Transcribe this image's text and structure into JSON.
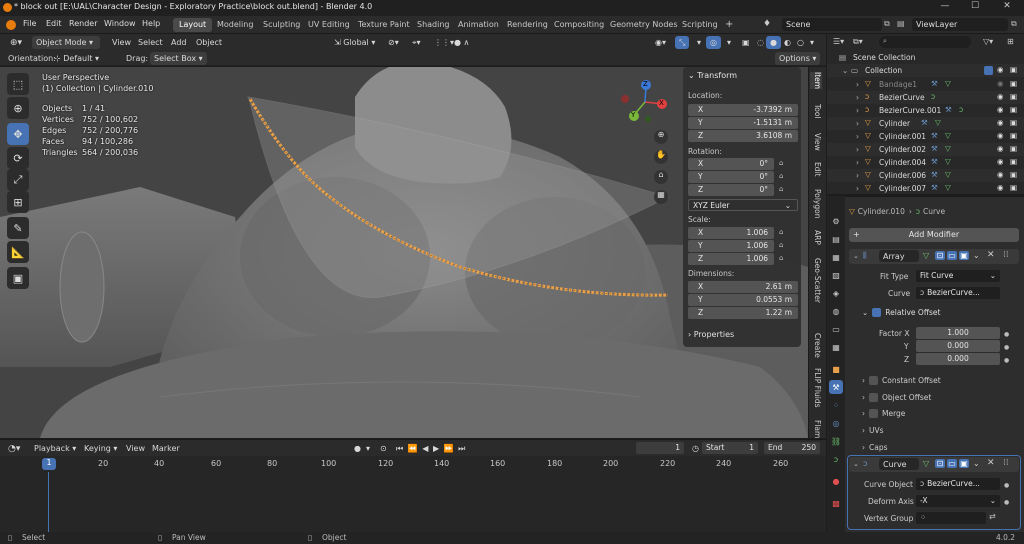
{
  "titlebar": {
    "title": "* block out [E:\\UAL\\Character Design - Exploratory Practice\\block out.blend] - Blender 4.0",
    "min": "—",
    "max": "☐",
    "close": "✕"
  },
  "menu": [
    "File",
    "Edit",
    "Render",
    "Window",
    "Help"
  ],
  "workspaces": [
    "Layout",
    "Modeling",
    "Sculpting",
    "UV Editing",
    "Texture Paint",
    "Shading",
    "Animation",
    "Rendering",
    "Compositing",
    "Geometry Nodes",
    "Scripting"
  ],
  "workspace_add": "+",
  "scene": "Scene",
  "view_layer": "ViewLayer",
  "viewport_header": {
    "mode": "Object Mode",
    "view": "View",
    "select": "Select",
    "add": "Add",
    "object": "Object",
    "transform_orientation": "Global",
    "orientation_label": "Orientation:",
    "orientation_value": "Default",
    "drag_label": "Drag:",
    "drag_value": "Select Box",
    "options": "Options"
  },
  "viewport_overlay": {
    "perspective": "User Perspective",
    "collection_line": "(1) Collection | Cylinder.010",
    "stats": [
      {
        "label": "Objects",
        "value": "1 / 41"
      },
      {
        "label": "Vertices",
        "value": "752 / 100,602"
      },
      {
        "label": "Edges",
        "value": "752 / 200,776"
      },
      {
        "label": "Faces",
        "value": "94 / 100,286"
      },
      {
        "label": "Triangles",
        "value": "564 / 200,036"
      }
    ],
    "gizmo": {
      "x": "X",
      "y": "Y",
      "z": "Z"
    }
  },
  "npanel": {
    "transform": "Transform",
    "location_label": "Location:",
    "location": [
      {
        "axis": "X",
        "value": "-3.7392 m"
      },
      {
        "axis": "Y",
        "value": "-1.5131 m"
      },
      {
        "axis": "Z",
        "value": "3.6108 m"
      }
    ],
    "rotation_label": "Rotation:",
    "rotation": [
      {
        "axis": "X",
        "value": "0°"
      },
      {
        "axis": "Y",
        "value": "0°"
      },
      {
        "axis": "Z",
        "value": "0°"
      }
    ],
    "rotation_mode": "XYZ Euler",
    "scale_label": "Scale:",
    "scale": [
      {
        "axis": "X",
        "value": "1.006"
      },
      {
        "axis": "Y",
        "value": "1.006"
      },
      {
        "axis": "Z",
        "value": "1.006"
      }
    ],
    "dimensions_label": "Dimensions:",
    "dimensions": [
      {
        "axis": "X",
        "value": "2.61 m"
      },
      {
        "axis": "Y",
        "value": "0.0553 m"
      },
      {
        "axis": "Z",
        "value": "1.22 m"
      }
    ],
    "properties": "Properties"
  },
  "ntabs": [
    "Item",
    "Tool",
    "View",
    "Edit",
    "Polygon",
    "ARP",
    "Geo-Scatter",
    "Create",
    "FLIP Fluids",
    "Flam"
  ],
  "outliner": {
    "scene_collection": "Scene Collection",
    "collection": "Collection",
    "items": [
      "Bandage1",
      "BezierCurve",
      "BezierCurve.001",
      "Cylinder",
      "Cylinder.001",
      "Cylinder.002",
      "Cylinder.004",
      "Cylinder.006",
      "Cylinder.007"
    ]
  },
  "properties": {
    "object_name": "Cylinder.010",
    "data_name": "Curve",
    "add_modifier": "Add Modifier",
    "array": {
      "name": "Array",
      "fit_type_label": "Fit Type",
      "fit_type": "Fit Curve",
      "curve_label": "Curve",
      "curve": "BezierCurve...",
      "relative_offset": "Relative Offset",
      "factor_x_label": "Factor X",
      "factor_x": "1.000",
      "y_label": "Y",
      "y": "0.000",
      "z_label": "Z",
      "z": "0.000",
      "constant_offset": "Constant Offset",
      "object_offset": "Object Offset",
      "merge": "Merge",
      "uvs": "UVs",
      "caps": "Caps"
    },
    "curve_mod": {
      "name": "Curve",
      "curve_object_label": "Curve Object",
      "curve_object": "BezierCurve...",
      "deform_axis_label": "Deform Axis",
      "deform_axis": "-X",
      "vertex_group_label": "Vertex Group"
    }
  },
  "timeline": {
    "playback": "Playback",
    "keying": "Keying",
    "view": "View",
    "marker": "Marker",
    "current_frame": "1",
    "start_label": "Start",
    "start": "1",
    "end_label": "End",
    "end": "250",
    "ticks": [
      "1",
      "20",
      "40",
      "60",
      "80",
      "100",
      "120",
      "140",
      "160",
      "180",
      "200",
      "220",
      "240",
      "260"
    ]
  },
  "statusbar": {
    "select": "Select",
    "pan_view": "Pan View",
    "object": "Object",
    "version": "4.0.2"
  },
  "colors": {
    "accent": "#4772b3",
    "orange": "#e8a04a",
    "viewport_bg": "#444444"
  }
}
